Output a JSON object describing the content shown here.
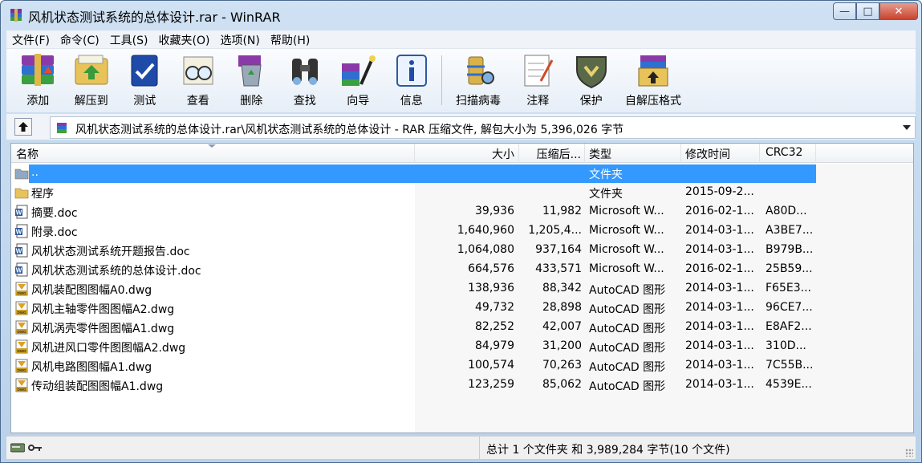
{
  "window": {
    "title": "风机状态测试系统的总体设计.rar - WinRAR"
  },
  "menu": [
    {
      "id": "file",
      "label": "文件(F)"
    },
    {
      "id": "commands",
      "label": "命令(C)"
    },
    {
      "id": "tools",
      "label": "工具(S)"
    },
    {
      "id": "favorites",
      "label": "收藏夹(O)"
    },
    {
      "id": "options",
      "label": "选项(N)"
    },
    {
      "id": "help",
      "label": "帮助(H)"
    }
  ],
  "toolbar": [
    {
      "id": "add",
      "label": "添加",
      "icon": "books-icon"
    },
    {
      "id": "extract",
      "label": "解压到",
      "icon": "extract-folder-icon"
    },
    {
      "id": "test",
      "label": "测试",
      "icon": "test-book-icon"
    },
    {
      "id": "view",
      "label": "查看",
      "icon": "glasses-icon"
    },
    {
      "id": "delete",
      "label": "删除",
      "icon": "recycle-bin-icon"
    },
    {
      "id": "find",
      "label": "查找",
      "icon": "binoculars-icon"
    },
    {
      "id": "wizard",
      "label": "向导",
      "icon": "wizard-icon"
    },
    {
      "id": "info",
      "label": "信息",
      "icon": "info-icon"
    },
    {
      "id": "scan",
      "label": "扫描病毒",
      "icon": "virus-scan-icon"
    },
    {
      "id": "comment",
      "label": "注释",
      "icon": "comment-note-icon"
    },
    {
      "id": "protect",
      "label": "保护",
      "icon": "shield-icon"
    },
    {
      "id": "sfx",
      "label": "自解压格式",
      "icon": "sfx-box-icon"
    }
  ],
  "address": {
    "text": "风机状态测试系统的总体设计.rar\\风机状态测试系统的总体设计 - RAR 压缩文件, 解包大小为 5,396,026 字节"
  },
  "columns": {
    "name": "名称",
    "size": "大小",
    "packed": "压缩后...",
    "type": "类型",
    "modified": "修改时间",
    "crc": "CRC32"
  },
  "files": [
    {
      "name": "..",
      "size": "",
      "packed": "",
      "type": "文件夹",
      "modified": "",
      "crc": "",
      "icon": "parent-folder-icon",
      "selected": true
    },
    {
      "name": "程序",
      "size": "",
      "packed": "",
      "type": "文件夹",
      "modified": "2015-09-2...",
      "crc": "",
      "icon": "folder-icon"
    },
    {
      "name": "摘要.doc",
      "size": "39,936",
      "packed": "11,982",
      "type": "Microsoft W...",
      "modified": "2016-02-1...",
      "crc": "A80D...",
      "icon": "word-doc-icon"
    },
    {
      "name": "附录.doc",
      "size": "1,640,960",
      "packed": "1,205,4...",
      "type": "Microsoft W...",
      "modified": "2014-03-1...",
      "crc": "A3BE7...",
      "icon": "word-doc-icon"
    },
    {
      "name": "风机状态测试系统开题报告.doc",
      "size": "1,064,080",
      "packed": "937,164",
      "type": "Microsoft W...",
      "modified": "2014-03-1...",
      "crc": "B979B...",
      "icon": "word-doc-icon"
    },
    {
      "name": "风机状态测试系统的总体设计.doc",
      "size": "664,576",
      "packed": "433,571",
      "type": "Microsoft W...",
      "modified": "2016-02-1...",
      "crc": "25B59...",
      "icon": "word-doc-icon"
    },
    {
      "name": "风机装配图图幅A0.dwg",
      "size": "138,936",
      "packed": "88,342",
      "type": "AutoCAD 图形",
      "modified": "2014-03-1...",
      "crc": "F65E3...",
      "icon": "dwg-file-icon"
    },
    {
      "name": "风机主轴零件图图幅A2.dwg",
      "size": "49,732",
      "packed": "28,898",
      "type": "AutoCAD 图形",
      "modified": "2014-03-1...",
      "crc": "96CE7...",
      "icon": "dwg-file-icon"
    },
    {
      "name": "风机涡壳零件图图幅A1.dwg",
      "size": "82,252",
      "packed": "42,007",
      "type": "AutoCAD 图形",
      "modified": "2014-03-1...",
      "crc": "E8AF2...",
      "icon": "dwg-file-icon"
    },
    {
      "name": "风机进风口零件图图幅A2.dwg",
      "size": "84,979",
      "packed": "31,200",
      "type": "AutoCAD 图形",
      "modified": "2014-03-1...",
      "crc": "310D...",
      "icon": "dwg-file-icon"
    },
    {
      "name": "风机电路图图幅A1.dwg",
      "size": "100,574",
      "packed": "70,263",
      "type": "AutoCAD 图形",
      "modified": "2014-03-1...",
      "crc": "7C55B...",
      "icon": "dwg-file-icon"
    },
    {
      "name": "传动组装配图图幅A1.dwg",
      "size": "123,259",
      "packed": "85,062",
      "type": "AutoCAD 图形",
      "modified": "2014-03-1...",
      "crc": "4539E...",
      "icon": "dwg-file-icon"
    }
  ],
  "status": {
    "text": "总计 1 个文件夹 和 3,989,284 字节(10 个文件)"
  }
}
